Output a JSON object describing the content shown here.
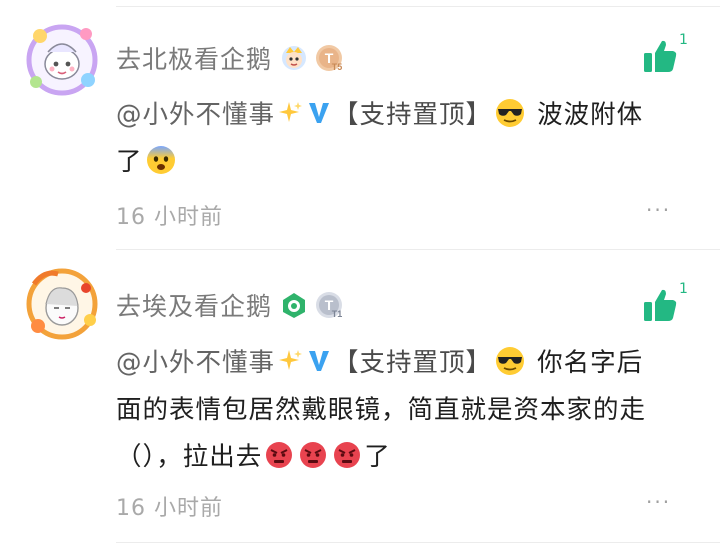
{
  "comments": [
    {
      "username": "去北极看企鹅",
      "mention": "@小外不懂事",
      "tag": "【支持置顶】",
      "text_after_tag": " 波波附体",
      "text_line2": "了",
      "time": "16 小时前",
      "likes": "1",
      "level_badge": "T5",
      "more": "···",
      "accent": "#23b883"
    },
    {
      "username": "去埃及看企鹅",
      "mention": "@小外不懂事",
      "tag": "【支持置顶】",
      "text_after_tag": " 你名字后",
      "text_line2": "面的表情包居然戴眼镜，简直就是资本家的走",
      "text_line3": "（），拉出去",
      "text_line3_end": "了",
      "time": "16 小时前",
      "likes": "1",
      "level_badge": "T1",
      "more": "···",
      "accent": "#23b883"
    }
  ]
}
